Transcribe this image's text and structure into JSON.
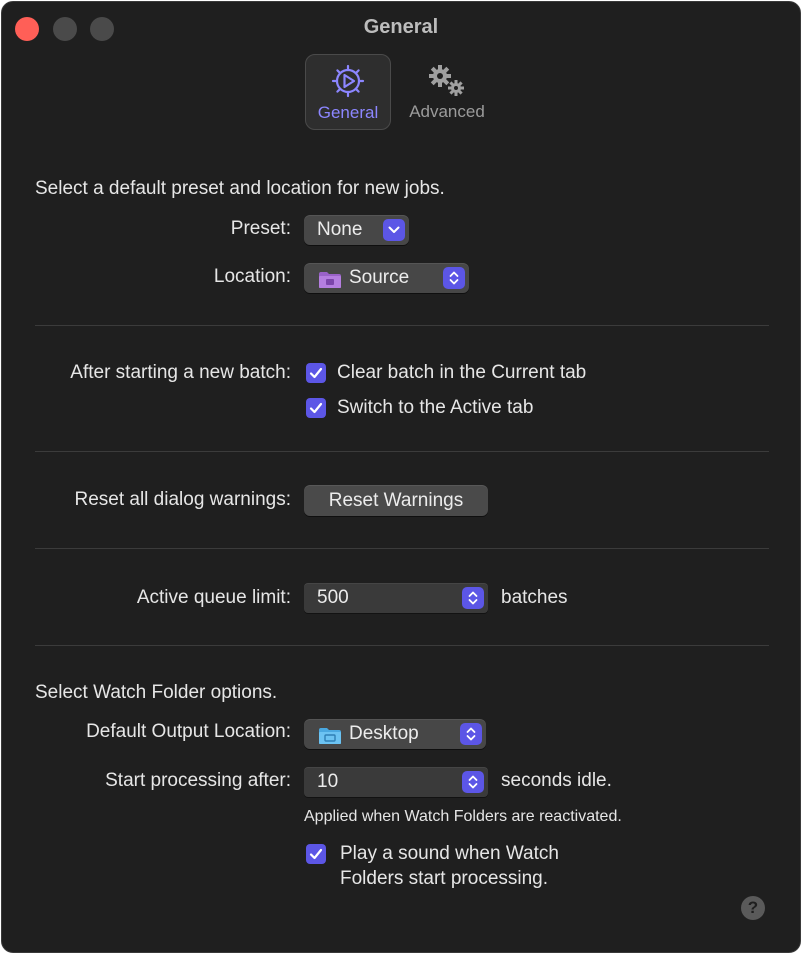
{
  "window": {
    "title": "General",
    "accent": "#5c56e6",
    "background": "#1f1f1f"
  },
  "tabs": [
    {
      "label": "General",
      "icon": "gear-play-icon",
      "selected": true
    },
    {
      "label": "Advanced",
      "icon": "gears-icon",
      "selected": false
    }
  ],
  "defaults_section": {
    "heading": "Select a default preset and location for new jobs.",
    "preset_label": "Preset:",
    "preset_value": "None",
    "location_label": "Location:",
    "location_value": "Source",
    "location_icon": "purple-folder-icon"
  },
  "batch_section": {
    "label": "After starting a new batch:",
    "options": [
      {
        "label": "Clear batch in the Current tab",
        "checked": true
      },
      {
        "label": "Switch to the Active tab",
        "checked": true
      }
    ]
  },
  "warnings_section": {
    "label": "Reset all dialog warnings:",
    "button_label": "Reset Warnings"
  },
  "queue_section": {
    "label": "Active queue limit:",
    "value": "500",
    "unit": "batches"
  },
  "watch_section": {
    "heading": "Select Watch Folder options.",
    "output_label": "Default Output Location:",
    "output_value": "Desktop",
    "output_icon": "blue-folder-icon",
    "idle_label": "Start processing after:",
    "idle_value": "10",
    "idle_unit": "seconds idle.",
    "note": "Applied when Watch Folders are reactivated.",
    "sound_line1": "Play a sound when Watch",
    "sound_line2": "Folders start processing.",
    "sound_checked": true
  },
  "help": {
    "label": "?"
  }
}
